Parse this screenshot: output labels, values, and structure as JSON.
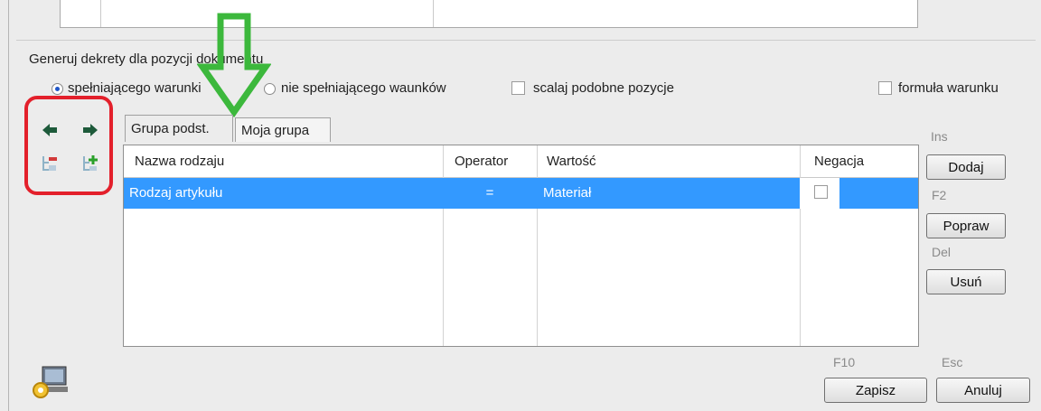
{
  "group": {
    "title": "Generuj dekrety dla pozycji dokumentu",
    "options": {
      "meeting": "spełniającego warunki",
      "not_meeting": "nie spełniającego waunków",
      "merge": "scalaj podobne pozycje",
      "formula": "formuła warunku"
    }
  },
  "tabs": [
    "Grupa podst.",
    "Moja grupa"
  ],
  "table": {
    "headers": [
      "Nazwa rodzaju",
      "Operator",
      "Wartość",
      "Negacja"
    ],
    "rows": [
      {
        "name": "Rodzaj artykułu",
        "operator": "=",
        "value": "Materiał",
        "negation": false
      }
    ]
  },
  "buttons": {
    "add": {
      "key": "Ins",
      "label": "Dodaj"
    },
    "edit": {
      "key": "F2",
      "label": "Popraw"
    },
    "delete": {
      "key": "Del",
      "label": "Usuń"
    },
    "save": {
      "key": "F10",
      "label": "Zapisz"
    },
    "cancel": {
      "key": "Esc",
      "label": "Anuluj"
    }
  },
  "colors": {
    "selection": "#3399ff",
    "highlight_box": "#e3202b",
    "annotation_arrow": "#3cb83c"
  },
  "icons": [
    "arrow-left-icon",
    "arrow-right-icon",
    "remove-node-icon",
    "add-node-icon",
    "gear-computer-icon"
  ]
}
